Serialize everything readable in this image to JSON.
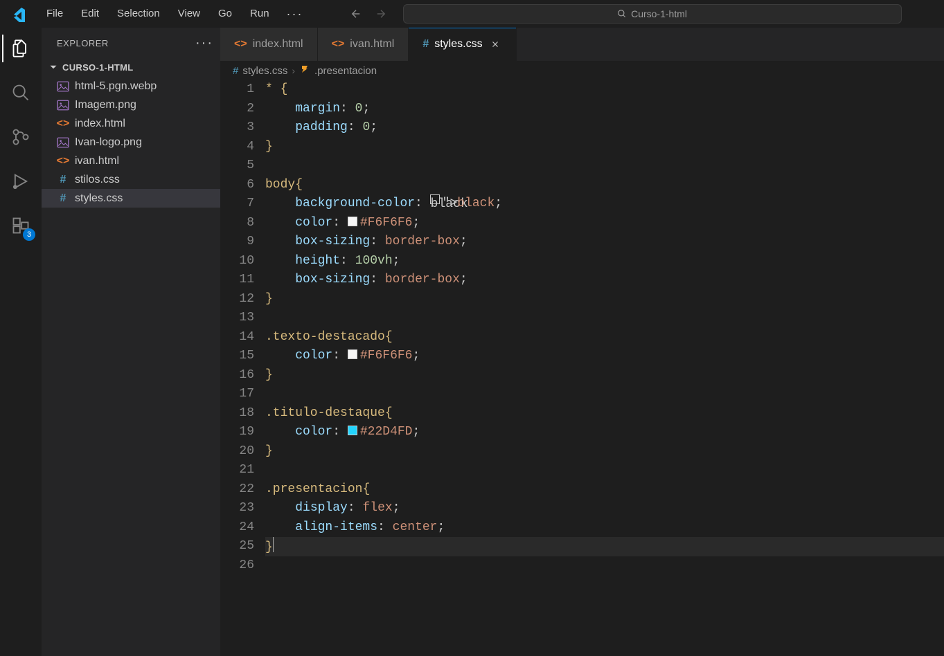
{
  "menu": {
    "file": "File",
    "edit": "Edit",
    "selection": "Selection",
    "view": "View",
    "go": "Go",
    "run": "Run"
  },
  "search": {
    "text": "Curso-1-html"
  },
  "sidebar": {
    "title": "EXPLORER",
    "project": "CURSO-1-HTML",
    "files": [
      {
        "name": "html-5.pgn.webp",
        "type": "image"
      },
      {
        "name": "Imagem.png",
        "type": "image"
      },
      {
        "name": "index.html",
        "type": "html"
      },
      {
        "name": "Ivan-logo.png",
        "type": "image"
      },
      {
        "name": "ivan.html",
        "type": "html"
      },
      {
        "name": "stilos.css",
        "type": "css"
      },
      {
        "name": "styles.css",
        "type": "css"
      }
    ],
    "selectedIndex": 6
  },
  "activitybar": {
    "badge": "3"
  },
  "tabs": [
    {
      "name": "index.html",
      "type": "html"
    },
    {
      "name": "ivan.html",
      "type": "html"
    },
    {
      "name": "styles.css",
      "type": "css",
      "active": true
    }
  ],
  "breadcrumb": [
    {
      "icon": "css",
      "text": "styles.css"
    },
    {
      "icon": "symbol",
      "text": ".presentacion"
    }
  ],
  "editor": {
    "lines": [
      "* {",
      "    margin: 0;",
      "    padding: 0;",
      "}",
      "",
      "body{",
      "    background-color: ⬚black;",
      "    color: ■#F6F6F6;",
      "    box-sizing: border-box;",
      "    height: 100vh;",
      "    box-sizing: border-box;",
      "}",
      "",
      ".texto-destacado{",
      "    color: ■#F6F6F6;",
      "}",
      "",
      ".titulo-destaque{",
      "    color: ▦#22D4FD;",
      "}",
      "",
      ".presentacion{",
      "    display: flex;",
      "    align-items: center;",
      "}",
      ""
    ]
  }
}
